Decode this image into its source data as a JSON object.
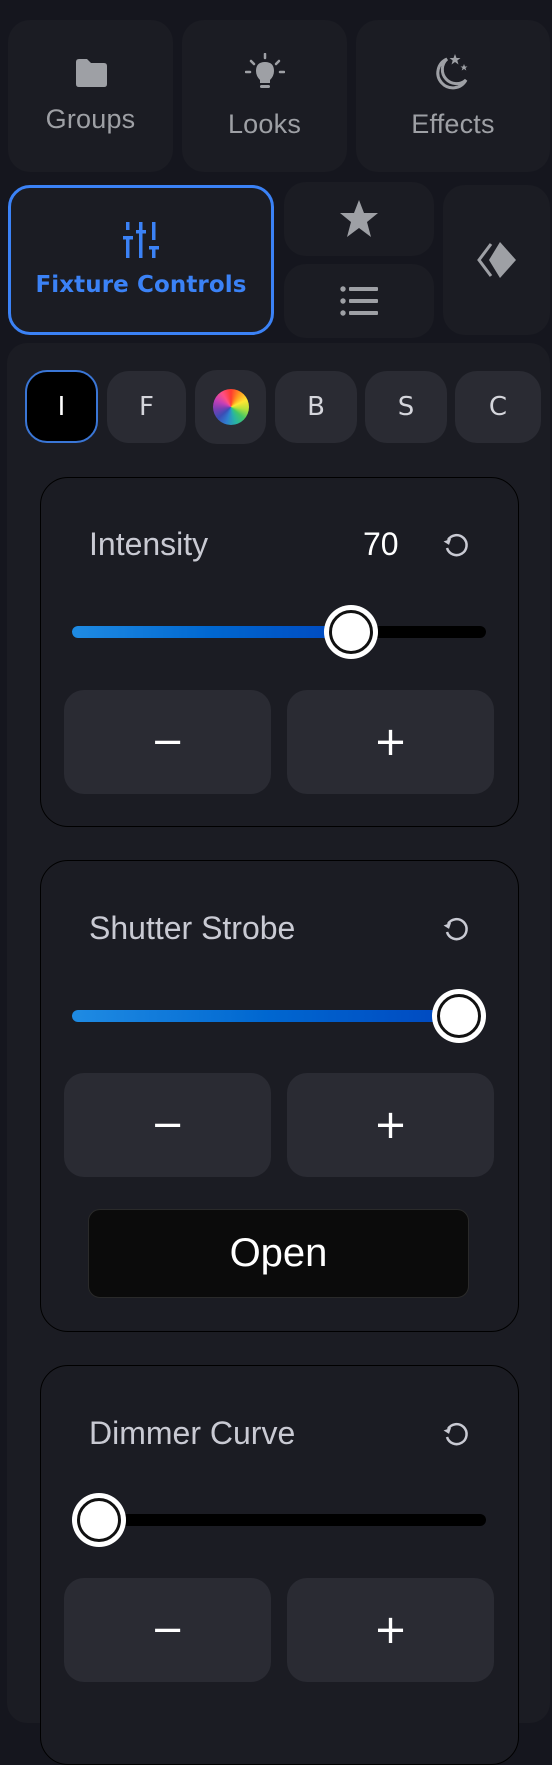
{
  "nav": {
    "groups": {
      "label": "Groups",
      "icon": "folder-icon"
    },
    "looks": {
      "label": "Looks",
      "icon": "lightbulb-icon"
    },
    "effects": {
      "label": "Effects",
      "icon": "moon-stars-icon"
    },
    "fixture_controls": {
      "label": "Fixture Controls",
      "icon": "sliders-icon",
      "active": true
    },
    "favorites": {
      "icon": "star-icon"
    },
    "list": {
      "icon": "list-icon"
    },
    "diamond": {
      "icon": "diamond-chevron-icon"
    }
  },
  "tabs": [
    {
      "label": "I",
      "active": true
    },
    {
      "label": "F"
    },
    {
      "label": "",
      "icon": "color-wheel-icon"
    },
    {
      "label": "B"
    },
    {
      "label": "S"
    },
    {
      "label": "C"
    }
  ],
  "controls": [
    {
      "title": "Intensity",
      "value": "70",
      "percent": 70,
      "minus": "−",
      "plus": "+"
    },
    {
      "title": "Shutter Strobe",
      "value": "",
      "percent": 100,
      "minus": "−",
      "plus": "+",
      "mode_button": "Open"
    },
    {
      "title": "Dimmer Curve",
      "value": "",
      "percent": 0,
      "minus": "−",
      "plus": "+"
    }
  ],
  "colors": {
    "accent": "#3b82f6",
    "background": "#15161e",
    "surface": "#1b1c23",
    "button": "#2a2b33",
    "icon_gray": "#9ea0a5"
  }
}
